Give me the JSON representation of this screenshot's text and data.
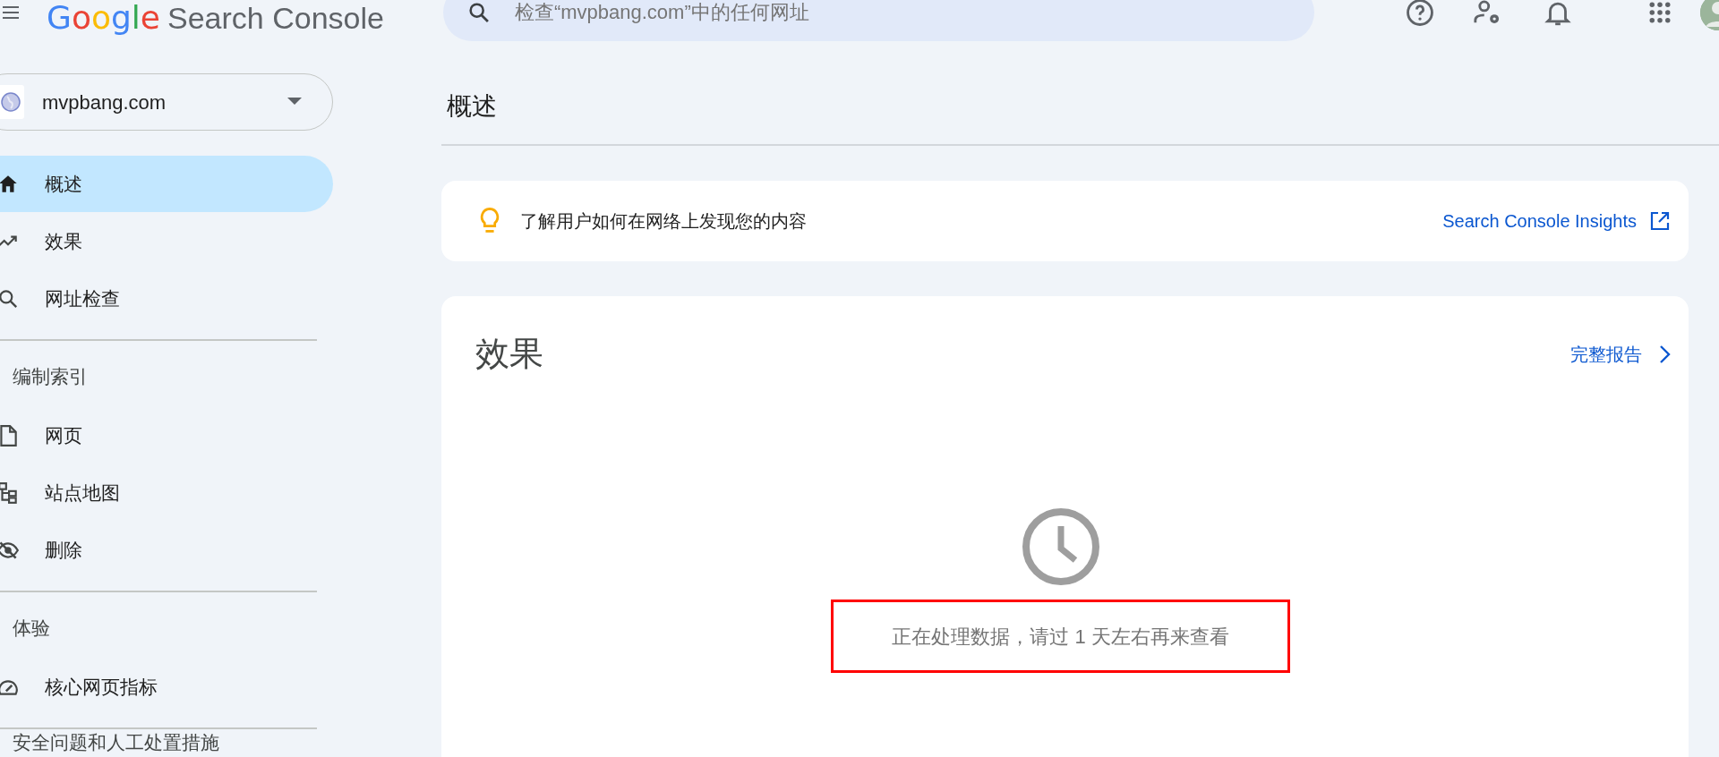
{
  "header": {
    "logo": {
      "brand": "Google",
      "product": "Search Console"
    },
    "search": {
      "placeholder": "检查“mvpbang.com”中的任何网址"
    }
  },
  "property": {
    "name": "mvpbang.com"
  },
  "sidebar": {
    "groups": [
      {
        "items": [
          {
            "label": "概述",
            "selected": true
          },
          {
            "label": "效果",
            "selected": false
          },
          {
            "label": "网址检查",
            "selected": false
          }
        ]
      },
      {
        "heading": "编制索引",
        "items": [
          {
            "label": "网页",
            "selected": false
          },
          {
            "label": "站点地图",
            "selected": false
          },
          {
            "label": "删除",
            "selected": false
          }
        ]
      },
      {
        "heading": "体验",
        "items": [
          {
            "label": "核心网页指标",
            "selected": false
          }
        ]
      },
      {
        "heading": "安全问题和人工处置措施"
      }
    ]
  },
  "main": {
    "title": "概述",
    "insight_card": {
      "text": "了解用户如何在网络上发现您的内容",
      "link": "Search Console Insights"
    },
    "performance_card": {
      "title": "效果",
      "link": "完整报告",
      "message": "正在处理数据，请过 1 天左右再来查看",
      "highlighted": true
    }
  }
}
